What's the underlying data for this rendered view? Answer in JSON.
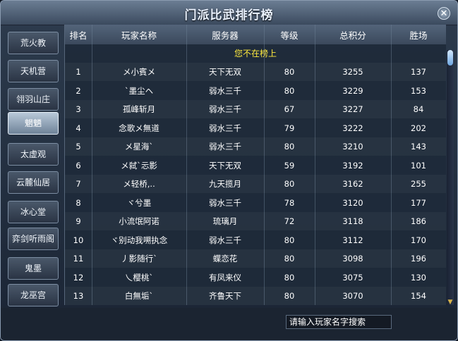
{
  "window": {
    "title": "门派比武排行榜",
    "close_icon": "close-icon"
  },
  "sidebar": {
    "items": [
      {
        "label": "荒火教",
        "active": false
      },
      {
        "label": "天机营",
        "active": false
      },
      {
        "label": "翎羽山庄",
        "active": false
      },
      {
        "label": "魍魉",
        "active": true
      },
      {
        "label": "太虚观",
        "active": false
      },
      {
        "label": "云麓仙居",
        "active": false
      },
      {
        "label": "冰心堂",
        "active": false
      },
      {
        "label": "弈剑听雨阁",
        "active": false
      },
      {
        "label": "鬼墨",
        "active": false
      },
      {
        "label": "龙巫宫",
        "active": false
      }
    ]
  },
  "table": {
    "headers": [
      "排名",
      "玩家名称",
      "服务器",
      "等级",
      "总积分",
      "胜场"
    ],
    "notice": "您不在榜上",
    "rows": [
      [
        "1",
        "メ小賓メ",
        "天下无双",
        "80",
        "3255",
        "137"
      ],
      [
        "2",
        "ˋ墨尘ヘ",
        "弱水三千",
        "80",
        "3229",
        "153"
      ],
      [
        "3",
        "孤峰斩月",
        "弱水三千",
        "67",
        "3227",
        "84"
      ],
      [
        "4",
        "念歌メ無道",
        "弱水三千",
        "79",
        "3222",
        "202"
      ],
      [
        "5",
        "メ星海ˋ",
        "弱水三千",
        "80",
        "3210",
        "143"
      ],
      [
        "6",
        "メ弑ˋ忈影",
        "天下无双",
        "59",
        "3192",
        "101"
      ],
      [
        "7",
        "メ轻桥,..",
        "九天揽月",
        "80",
        "3162",
        "255"
      ],
      [
        "8",
        "ヾ兮墨",
        "弱水三千",
        "78",
        "3120",
        "177"
      ],
      [
        "9",
        "小流氓阿诺",
        "琉璃月",
        "72",
        "3118",
        "186"
      ],
      [
        "10",
        "ヾ别动我嗍执念",
        "弱水三千",
        "80",
        "3112",
        "170"
      ],
      [
        "11",
        "丿影随行ˋ",
        "蝶恋花",
        "80",
        "3098",
        "196"
      ],
      [
        "12",
        "乀樱桃ˋ",
        "有凤来仪",
        "80",
        "3075",
        "130"
      ],
      [
        "13",
        "白無垢ˋ",
        "齐鲁天下",
        "80",
        "3070",
        "154"
      ]
    ]
  },
  "search": {
    "placeholder": "请输入玩家名字搜索"
  },
  "colors": {
    "notice": "#ffea3d",
    "title": "#eaf2ff"
  }
}
